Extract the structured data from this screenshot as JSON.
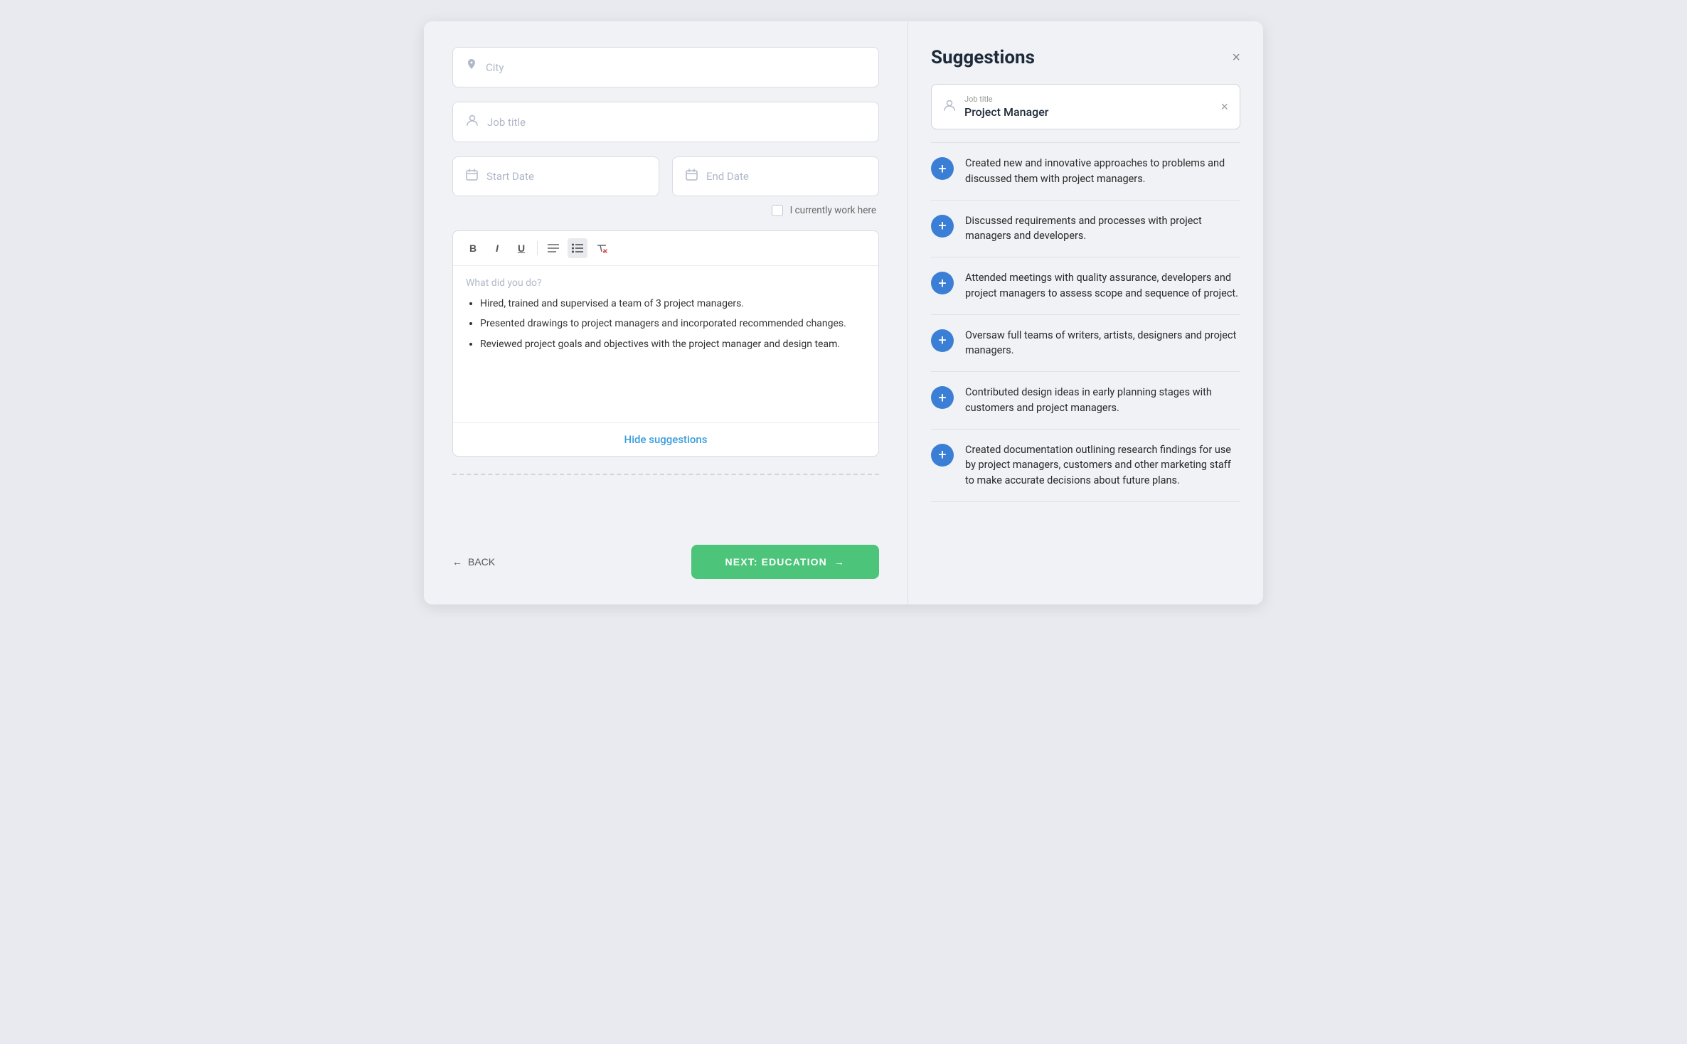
{
  "left": {
    "city_placeholder": "City",
    "job_title_placeholder": "Job title",
    "start_date_placeholder": "Start Date",
    "end_date_placeholder": "End Date",
    "currently_work_label": "I currently work here",
    "editor_placeholder": "What did you do?",
    "editor_bullets": [
      "Hired, trained and supervised a team of 3 project managers.",
      "Presented drawings to project managers and incorporated recommended changes.",
      "Reviewed project goals and objectives with the project manager and design team."
    ],
    "hide_suggestions_label": "Hide suggestions",
    "back_label": "BACK",
    "next_label": "NEXT: EDUCATION"
  },
  "right": {
    "title": "Suggestions",
    "close_icon": "×",
    "job_field_label": "Job title",
    "job_field_value": "Project Manager",
    "clear_icon": "×",
    "suggestions": [
      "Created new and innovative approaches to problems and discussed them with project managers.",
      "Discussed requirements and processes with project managers and developers.",
      "Attended meetings with quality assurance, developers and project managers to assess scope and sequence of project.",
      "Oversaw full teams of writers, artists, designers and project managers.",
      "Contributed design ideas in early planning stages with customers and project managers.",
      "Created documentation outlining research findings for use by project managers, customers and other marketing staff to make accurate decisions about future plans."
    ]
  },
  "icons": {
    "location": "📍",
    "person": "👤",
    "calendar": "📅",
    "bold": "B",
    "italic": "I",
    "underline": "U",
    "align": "≡",
    "list": "≡",
    "filter": "⚡",
    "arrow_left": "←",
    "arrow_right": "→",
    "plus": "+"
  }
}
